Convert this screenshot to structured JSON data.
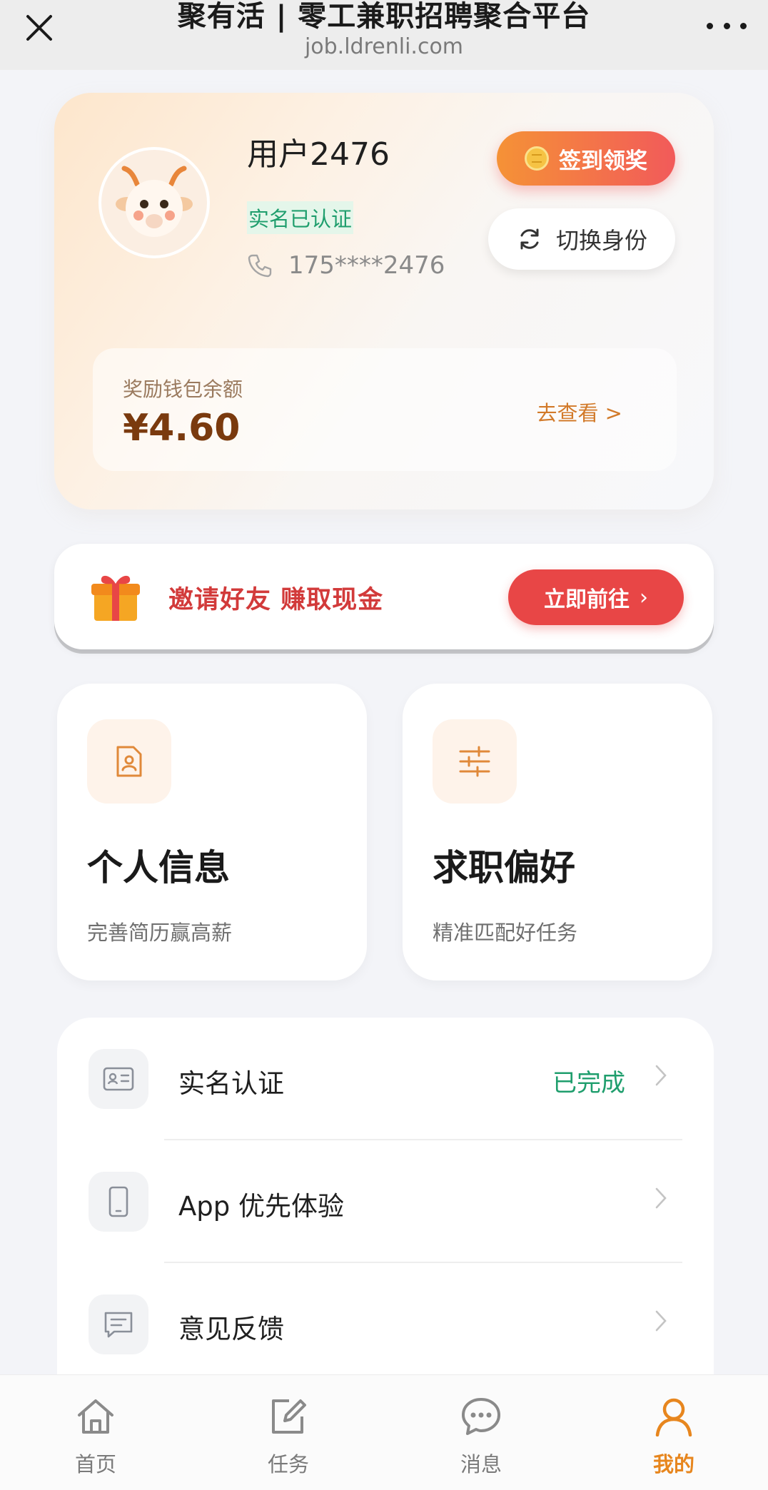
{
  "topbar": {
    "title": "聚有活 | 零工兼职招聘聚合平台",
    "url": "job.ldrenli.com"
  },
  "profile": {
    "username": "用户2476",
    "verified": "实名已认证",
    "phone": "175****2476",
    "signin_label": "签到领奖",
    "switch_label": "切换身份"
  },
  "wallet": {
    "label": "奖励钱包余额",
    "amount": "¥4.60",
    "link": "去查看 >"
  },
  "invite": {
    "text": "邀请好友 赚取现金",
    "button": "立即前往"
  },
  "features": [
    {
      "title": "个人信息",
      "subtitle": "完善简历赢高薪",
      "icon": "resume-icon"
    },
    {
      "title": "求职偏好",
      "subtitle": "精准匹配好任务",
      "icon": "sliders-icon"
    }
  ],
  "menu": [
    {
      "label": "实名认证",
      "status": "已完成",
      "icon": "id-card-icon"
    },
    {
      "label": "App 优先体验",
      "status": "",
      "icon": "phone-icon"
    },
    {
      "label": "意见反馈",
      "status": "",
      "icon": "feedback-icon"
    }
  ],
  "tabs": [
    {
      "label": "首页",
      "icon": "home-icon"
    },
    {
      "label": "任务",
      "icon": "edit-icon"
    },
    {
      "label": "消息",
      "icon": "chat-icon"
    },
    {
      "label": "我的",
      "icon": "user-icon",
      "active": true
    }
  ],
  "colors": {
    "accent": "#e7861e",
    "brand_red": "#e84646",
    "success_green": "#1f9e6d",
    "wallet_amount": "#7a3a0e"
  }
}
